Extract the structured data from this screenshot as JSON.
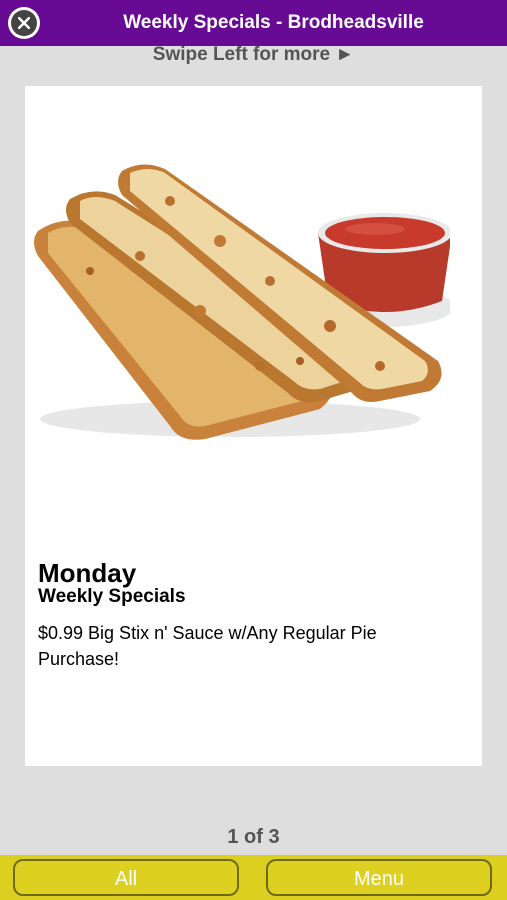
{
  "header": {
    "title": "Weekly Specials - Brodheadsville",
    "close_icon": "close-icon"
  },
  "swipe_hint": "Swipe Left for more ►",
  "special": {
    "image_icon": "breadsticks-with-sauce-image",
    "day": "Monday",
    "subtitle": "Weekly Specials",
    "description": "$0.99 Big Stix n' Sauce w/Any Regular Pie Purchase!"
  },
  "pager": "1 of 3",
  "footer": {
    "all_label": "All",
    "menu_label": "Menu"
  },
  "colors": {
    "header_bg": "#670b95",
    "footer_bg": "#dccf1f",
    "page_bg": "#dedede"
  }
}
